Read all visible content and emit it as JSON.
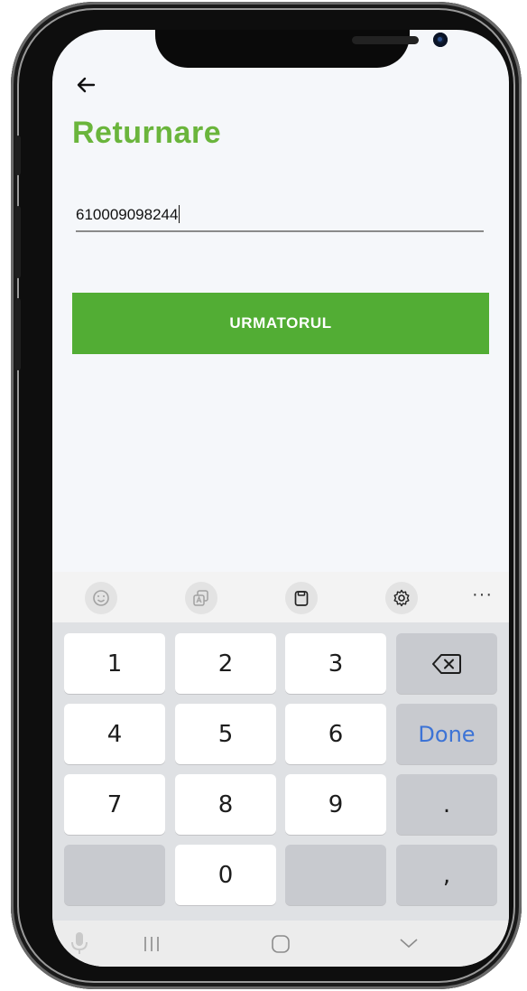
{
  "header": {
    "back_icon": "arrow-left-icon",
    "title": "Returnare"
  },
  "form": {
    "barcode_value": "610009098244",
    "next_label": "URMATORUL"
  },
  "colors": {
    "accent": "#6ab53c",
    "button": "#52ad34",
    "done_text": "#3c73d6"
  },
  "keyboard": {
    "toolbar_icons": [
      "emoji-icon",
      "sticker-icon",
      "clipboard-icon",
      "settings-icon"
    ],
    "more_label": "···",
    "keys": {
      "k1": "1",
      "k2": "2",
      "k3": "3",
      "k4": "4",
      "k5": "5",
      "k6": "6",
      "k7": "7",
      "k8": "8",
      "k9": "9",
      "k0": "0",
      "done": "Done",
      "dot": ".",
      "comma": ","
    }
  },
  "nav": {
    "icons": [
      "mic-icon",
      "recents-icon",
      "home-icon",
      "hide-keyboard-icon"
    ]
  }
}
